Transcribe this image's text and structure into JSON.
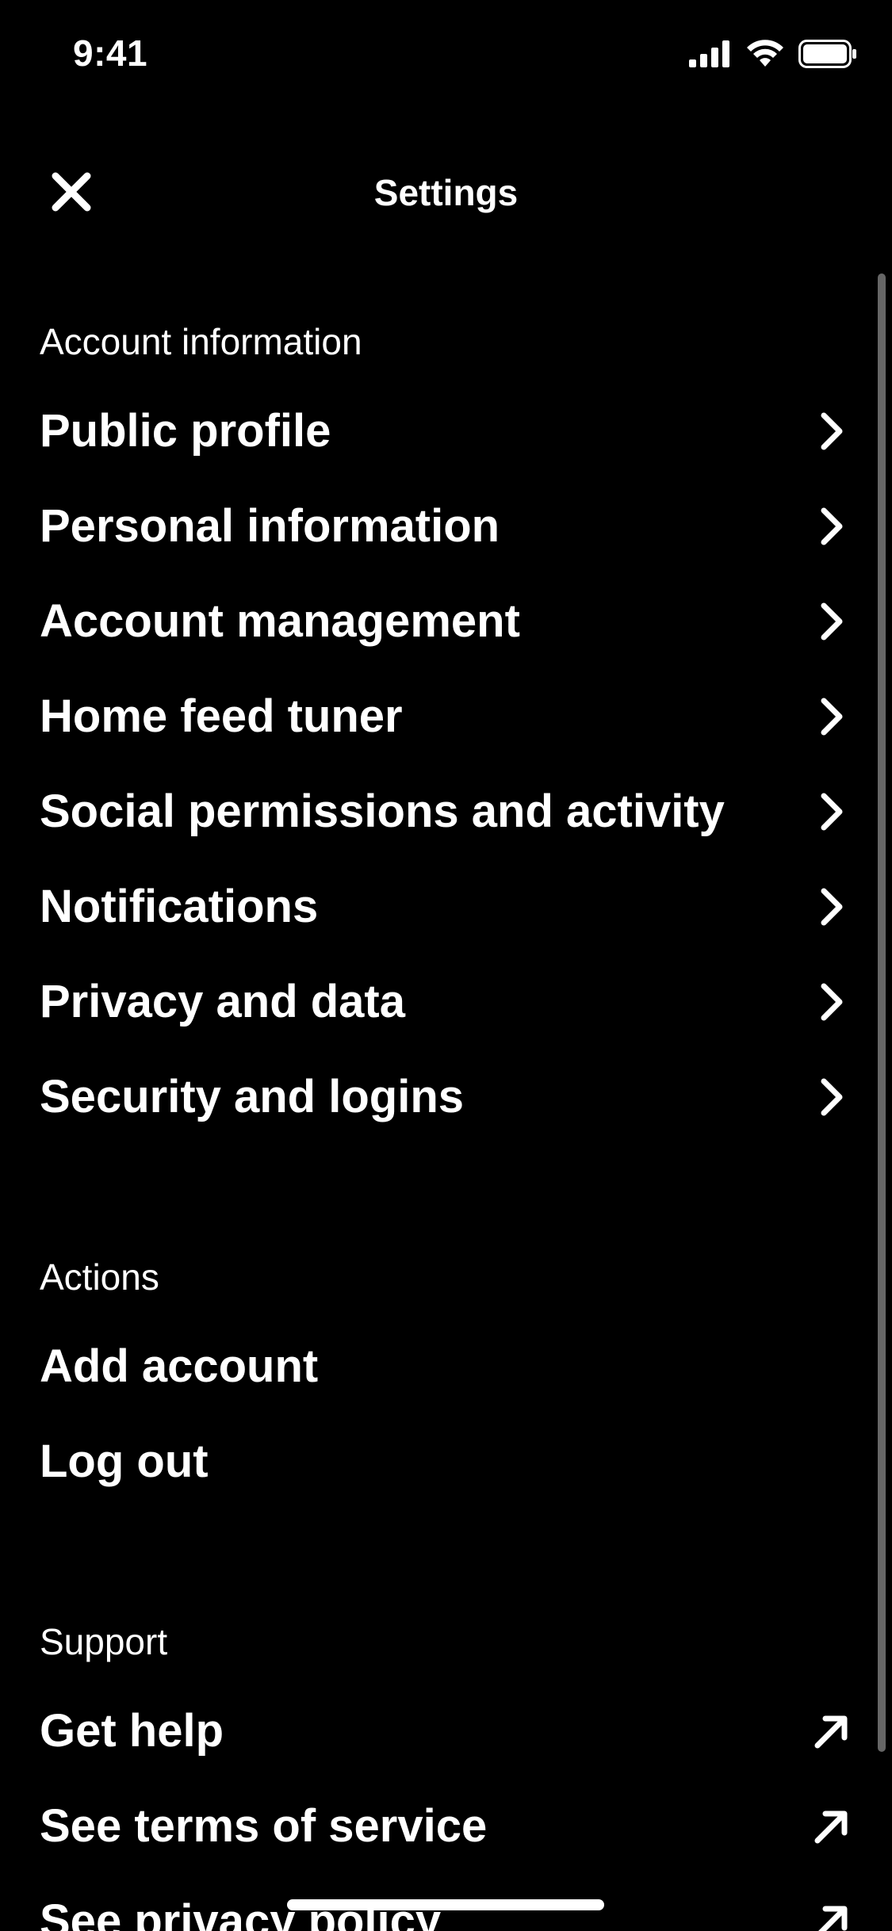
{
  "status_bar": {
    "time": "9:41",
    "icons": [
      "cellular-signal-icon",
      "wifi-icon",
      "battery-icon"
    ]
  },
  "header": {
    "title": "Settings",
    "close_icon": "close-icon"
  },
  "sections": {
    "account": {
      "label": "Account information",
      "items": [
        {
          "label": "Public profile",
          "icon": "chevron-right-icon"
        },
        {
          "label": "Personal information",
          "icon": "chevron-right-icon"
        },
        {
          "label": "Account management",
          "icon": "chevron-right-icon"
        },
        {
          "label": "Home feed tuner",
          "icon": "chevron-right-icon"
        },
        {
          "label": "Social permissions and activity",
          "icon": "chevron-right-icon"
        },
        {
          "label": "Notifications",
          "icon": "chevron-right-icon"
        },
        {
          "label": "Privacy and data",
          "icon": "chevron-right-icon"
        },
        {
          "label": "Security and logins",
          "icon": "chevron-right-icon"
        }
      ]
    },
    "actions": {
      "label": "Actions",
      "items": [
        {
          "label": "Add account"
        },
        {
          "label": "Log out"
        }
      ]
    },
    "support": {
      "label": "Support",
      "items": [
        {
          "label": "Get help",
          "icon": "external-link-arrow-icon"
        },
        {
          "label": "See terms of service",
          "icon": "external-link-arrow-icon"
        },
        {
          "label": "See privacy policy",
          "icon": "external-link-arrow-icon"
        }
      ]
    }
  },
  "colors": {
    "background": "#000000",
    "text": "#ffffff",
    "scrollbar": "#666666"
  }
}
